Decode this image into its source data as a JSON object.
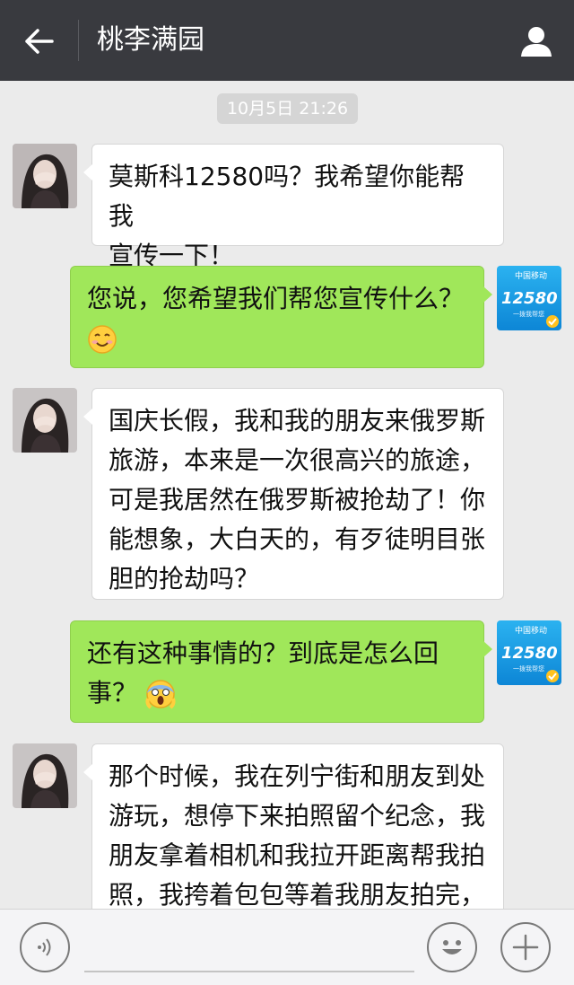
{
  "header": {
    "title": "桃李满园",
    "back_icon": "arrow-left-icon",
    "profile_icon": "person-icon"
  },
  "chat": {
    "timestamp": "10月5日 21:26",
    "messages": [
      {
        "side": "left",
        "lines": [
          "莫斯科12580吗？我希望你能帮我",
          "宣传一下！"
        ]
      },
      {
        "side": "right",
        "lines": [
          "您说，您希望我们帮您宣传什么？"
        ],
        "emoji": "smiling-face-icon"
      },
      {
        "side": "left",
        "lines": [
          "国庆长假，我和我的朋友来俄罗斯",
          "旅游，本来是一次很高兴的旅途，",
          "可是我居然在俄罗斯被抢劫了！你",
          "能想象，大白天的，有歹徒明目张",
          "胆的抢劫吗？"
        ]
      },
      {
        "side": "right",
        "lines": [
          "还有这种事情的？到底是怎么回",
          "事？"
        ],
        "emoji": "screaming-face-icon"
      },
      {
        "side": "left",
        "lines": [
          "那个时候，我在列宁街和朋友到处",
          "游玩，想停下来拍照留个纪念，我",
          "朋友拿着相机和我拉开距离帮我拍",
          "照，我挎着包包等着我朋友拍完，"
        ]
      }
    ],
    "right_avatar": {
      "brand_top": "中国移动",
      "brand_number": "12580",
      "brand_sub": "一拨我帮您"
    }
  },
  "input": {
    "voice_icon": "voice-icon",
    "emoji_icon": "emoji-icon",
    "plus_icon": "plus-icon"
  },
  "colors": {
    "header_bg": "#393a3f",
    "chat_bg": "#ebebeb",
    "bubble_right": "#a0e75a",
    "bubble_left": "#ffffff",
    "brand_blue": "#1a9ee8"
  }
}
